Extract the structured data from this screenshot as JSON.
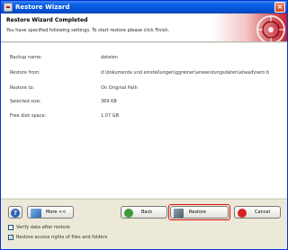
{
  "window": {
    "title": "Restore Wizard",
    "close_glyph": "×"
  },
  "header": {
    "title": "Restore Wizard Completed",
    "subtitle": "You have specified following settings. To start restore please click Finish."
  },
  "details": [
    {
      "key": "Backup name:",
      "value": "dateien"
    },
    {
      "key": "Restore from:",
      "value": "d:\\dokumente und einstellungen\\ggreiner\\anwendungsdaten\\ahead\\nero b"
    },
    {
      "key": "Restore to:",
      "value": "On Original Path"
    },
    {
      "key": "Selected size:",
      "value": "369 KB"
    },
    {
      "key": "Free disk space:",
      "value": "1.07 GB"
    }
  ],
  "buttons": {
    "help_glyph": "?",
    "more": "More <<",
    "back": "Back",
    "restore": "Restore",
    "cancel": "Cancel"
  },
  "options": [
    {
      "label": "Verify data after restore",
      "checked": false
    },
    {
      "label": "Restore access rights of files and folders",
      "checked": true
    }
  ],
  "icons": [
    "app-icon",
    "close-icon",
    "help-icon",
    "more-icon",
    "back-arrow-icon",
    "restore-icon",
    "cancel-icon",
    "vault-header-art"
  ],
  "colors": {
    "titlebar": "#0453d7",
    "highlight": "#e01010",
    "header_art": "#c4202a"
  }
}
